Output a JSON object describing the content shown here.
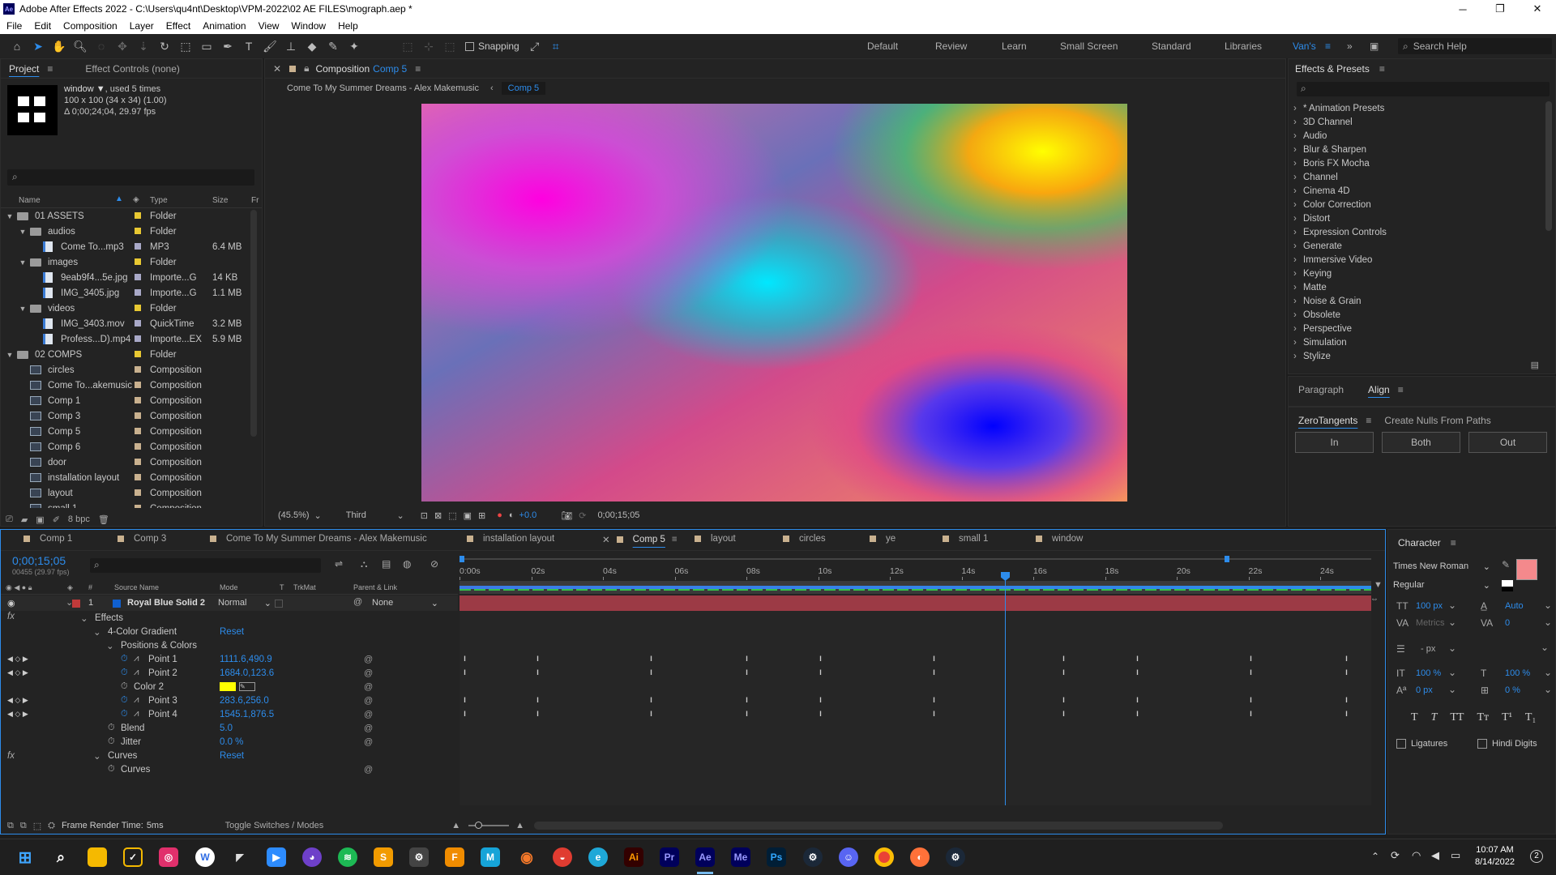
{
  "window": {
    "title": "Adobe After Effects 2022 - C:\\Users\\qu4nt\\Desktop\\VPM-2022\\02 AE FILES\\mograph.aep *",
    "min": "─",
    "max": "❐",
    "close": "✕"
  },
  "menu": [
    "File",
    "Edit",
    "Composition",
    "Layer",
    "Effect",
    "Animation",
    "View",
    "Window",
    "Help"
  ],
  "toolbar": {
    "snapping": "Snapping"
  },
  "workspaces": [
    "Default",
    "Review",
    "Learn",
    "Small Screen",
    "Standard",
    "Libraries",
    "Van's"
  ],
  "search_help": "Search Help",
  "project": {
    "tab_project": "Project",
    "tab_effect_controls": "Effect Controls (none)",
    "item_name": "window ▼",
    "used": ", used 5 times",
    "info1": "100 x 100  (34 x 34) (1.00)",
    "info2": "Δ 0;00;24;04, 29.97 fps",
    "columns": {
      "name": "Name",
      "type": "Type",
      "size": "Size",
      "fr": "Fr"
    },
    "items": [
      {
        "indent": 0,
        "tw": "▼",
        "icon": "folder",
        "name": "01 ASSETS",
        "type": "Folder",
        "size": "",
        "color": "#e8c832"
      },
      {
        "indent": 1,
        "tw": "▼",
        "icon": "folder",
        "name": "audios",
        "type": "Folder",
        "size": "",
        "color": "#e8c832"
      },
      {
        "indent": 2,
        "tw": "",
        "icon": "file",
        "name": "Come To...mp3",
        "type": "MP3",
        "size": "6.4 MB",
        "color": "#a9a9c8"
      },
      {
        "indent": 1,
        "tw": "▼",
        "icon": "folder",
        "name": "images",
        "type": "Folder",
        "size": "",
        "color": "#e8c832"
      },
      {
        "indent": 2,
        "tw": "",
        "icon": "file",
        "name": "9eab9f4...5e.jpg",
        "type": "Importe...G",
        "size": "14 KB",
        "color": "#a9a9c8"
      },
      {
        "indent": 2,
        "tw": "",
        "icon": "file",
        "name": "IMG_3405.jpg",
        "type": "Importe...G",
        "size": "1.1 MB",
        "color": "#a9a9c8"
      },
      {
        "indent": 1,
        "tw": "▼",
        "icon": "folder",
        "name": "videos",
        "type": "Folder",
        "size": "",
        "color": "#e8c832"
      },
      {
        "indent": 2,
        "tw": "",
        "icon": "file",
        "name": "IMG_3403.mov",
        "type": "QuickTime",
        "size": "3.2 MB",
        "color": "#a9a9c8"
      },
      {
        "indent": 2,
        "tw": "",
        "icon": "file",
        "name": "Profess...D).mp4",
        "type": "Importe...EX",
        "size": "5.9 MB",
        "color": "#a9a9c8"
      },
      {
        "indent": 0,
        "tw": "▼",
        "icon": "folder",
        "name": "02 COMPS",
        "type": "Folder",
        "size": "",
        "color": "#e8c832"
      },
      {
        "indent": 1,
        "tw": "",
        "icon": "comp",
        "name": "circles",
        "type": "Composition",
        "size": "",
        "color": "#c9b18f"
      },
      {
        "indent": 1,
        "tw": "",
        "icon": "comp",
        "name": "Come To...akemusic",
        "type": "Composition",
        "size": "",
        "color": "#c9b18f"
      },
      {
        "indent": 1,
        "tw": "",
        "icon": "comp",
        "name": "Comp 1",
        "type": "Composition",
        "size": "",
        "color": "#c9b18f"
      },
      {
        "indent": 1,
        "tw": "",
        "icon": "comp",
        "name": "Comp 3",
        "type": "Composition",
        "size": "",
        "color": "#c9b18f"
      },
      {
        "indent": 1,
        "tw": "",
        "icon": "comp",
        "name": "Comp 5",
        "type": "Composition",
        "size": "",
        "color": "#c9b18f"
      },
      {
        "indent": 1,
        "tw": "",
        "icon": "comp",
        "name": "Comp 6",
        "type": "Composition",
        "size": "",
        "color": "#c9b18f"
      },
      {
        "indent": 1,
        "tw": "",
        "icon": "comp",
        "name": "door",
        "type": "Composition",
        "size": "",
        "color": "#c9b18f"
      },
      {
        "indent": 1,
        "tw": "",
        "icon": "comp",
        "name": "installation layout",
        "type": "Composition",
        "size": "",
        "color": "#c9b18f"
      },
      {
        "indent": 1,
        "tw": "",
        "icon": "comp",
        "name": "layout",
        "type": "Composition",
        "size": "",
        "color": "#c9b18f"
      },
      {
        "indent": 1,
        "tw": "",
        "icon": "comp",
        "name": "small 1",
        "type": "Composition",
        "size": "",
        "color": "#c9b18f"
      }
    ],
    "bpc": "8 bpc"
  },
  "composition": {
    "tab_label": "Composition",
    "tab_comp": "Comp 5",
    "breadcrumb1": "Come To My Summer Dreams - Alex Makemusic",
    "breadcrumb2": "Comp 5",
    "zoom": "(45.5%)",
    "resolution": "Third",
    "exposure": "+0.0",
    "timecode": "0;00;15;05"
  },
  "effects_presets": {
    "title": "Effects & Presets",
    "items": [
      "* Animation Presets",
      "3D Channel",
      "Audio",
      "Blur & Sharpen",
      "Boris FX Mocha",
      "Channel",
      "Cinema 4D",
      "Color Correction",
      "Distort",
      "Expression Controls",
      "Generate",
      "Immersive Video",
      "Keying",
      "Matte",
      "Noise & Grain",
      "Obsolete",
      "Perspective",
      "Simulation",
      "Stylize"
    ]
  },
  "align": {
    "tab_paragraph": "Paragraph",
    "tab_align": "Align"
  },
  "zerotangents": {
    "tab": "ZeroTangents",
    "tab2": "Create Nulls From Paths",
    "btn_in": "In",
    "btn_both": "Both",
    "btn_out": "Out"
  },
  "timeline": {
    "tabs": [
      "Comp 1",
      "Comp 3",
      "Come To My Summer Dreams - Alex Makemusic",
      "installation layout",
      "Comp 5",
      "layout",
      "circles",
      "ye",
      "small 1",
      "window"
    ],
    "timecode": "0;00;15;05",
    "frames": "00455 (29.97 fps)",
    "headers": {
      "source": "Source Name",
      "mode": "Mode",
      "t": "T",
      "trkmat": "TrkMat",
      "parent": "Parent & Link"
    },
    "layer": {
      "num": "1",
      "name": "Royal Blue Solid 2",
      "mode": "Normal",
      "parent": "None"
    },
    "props": [
      {
        "indent": 1,
        "label": "Effects",
        "value": "",
        "stop": false
      },
      {
        "indent": 2,
        "label": "4-Color Gradient",
        "value": "Reset",
        "stop": false
      },
      {
        "indent": 3,
        "label": "Positions & Colors",
        "value": "",
        "stop": false
      },
      {
        "indent": 4,
        "label": "Point 1",
        "value": "1111.6,490.9",
        "stop": true
      },
      {
        "indent": 4,
        "label": "Point 2",
        "value": "1684.0,123.6",
        "stop": true
      },
      {
        "indent": 4,
        "label": "Color 2",
        "value": "",
        "stop": false
      },
      {
        "indent": 4,
        "label": "Point 3",
        "value": "283.6,256.0",
        "stop": true
      },
      {
        "indent": 4,
        "label": "Point 4",
        "value": "1545.1,876.5",
        "stop": true
      },
      {
        "indent": 3,
        "label": "Blend",
        "value": "5.0",
        "stop": false
      },
      {
        "indent": 3,
        "label": "Jitter",
        "value": "0.0 %",
        "stop": false
      },
      {
        "indent": 2,
        "label": "Curves",
        "value": "Reset",
        "stop": false
      },
      {
        "indent": 3,
        "label": "Curves",
        "value": "",
        "stop": false
      }
    ],
    "ruler": [
      "0:00s",
      "02s",
      "04s",
      "06s",
      "08s",
      "10s",
      "12s",
      "14s",
      "16s",
      "18s",
      "20s",
      "22s",
      "24s"
    ],
    "render_time_label": "Frame Render Time:",
    "render_time": "5ms",
    "toggle": "Toggle Switches / Modes"
  },
  "character": {
    "title": "Character",
    "font": "Times New Roman",
    "style": "Regular",
    "size": "100 px",
    "leading": "Auto",
    "kerning": "Metrics",
    "tracking": "0",
    "stroke": "- px",
    "vscale": "100 %",
    "hscale": "100 %",
    "baseline": "0 px",
    "tsume": "0 %",
    "ligatures": "Ligatures",
    "hindi": "Hindi Digits"
  },
  "taskbar": {
    "time": "10:07 AM",
    "date": "8/14/2022",
    "notif": "2"
  }
}
